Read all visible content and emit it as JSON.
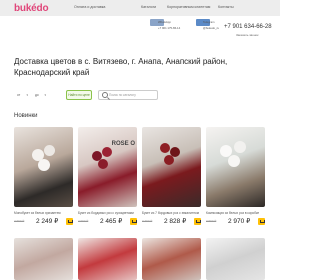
{
  "header": {
    "logo": "bukédo",
    "nav": [
      "Оплата и доставка",
      "Каталоги",
      "Корпоративным клиентам",
      "Контакты"
    ]
  },
  "contacts": {
    "whatsapp_label": "WhatsApp",
    "whatsapp_phone": "+7 901 175-86-14",
    "telegram_label": "Telegram",
    "telegram_handle": "@bukedo_ru",
    "phone": "+7 901 634-66-28",
    "callback": "Заказать звонок"
  },
  "page": {
    "title": "Доставка цветов в с. Витязево, г. Анапа, Анапский район, Краснодарский край"
  },
  "filters": {
    "from": "от",
    "to": "до",
    "chip": "Найти по цене",
    "search_placeholder": "Поиск по каталогу"
  },
  "section": {
    "title": "Новинки"
  },
  "products": [
    {
      "name": "Монобукет из белых хризантем",
      "old_price": "2 690 ₽",
      "price": "2 249 ₽"
    },
    {
      "name": "Букет из бордовых роз с сухоцветами",
      "old_price": "2 990 ₽",
      "price": "2 465 ₽",
      "tag": "ROSE O"
    },
    {
      "name": "Букет из 7 бордовых роз с эвкалиптом",
      "old_price": "3 390 ₽",
      "price": "2 828 ₽"
    },
    {
      "name": "Композиция из белых роз в коробке",
      "old_price": "3 590 ₽",
      "price": "2 970 ₽"
    }
  ],
  "colors": {
    "brand": "#e0467a",
    "accent": "#ffc107",
    "filter_chip": "#8bc34a"
  }
}
